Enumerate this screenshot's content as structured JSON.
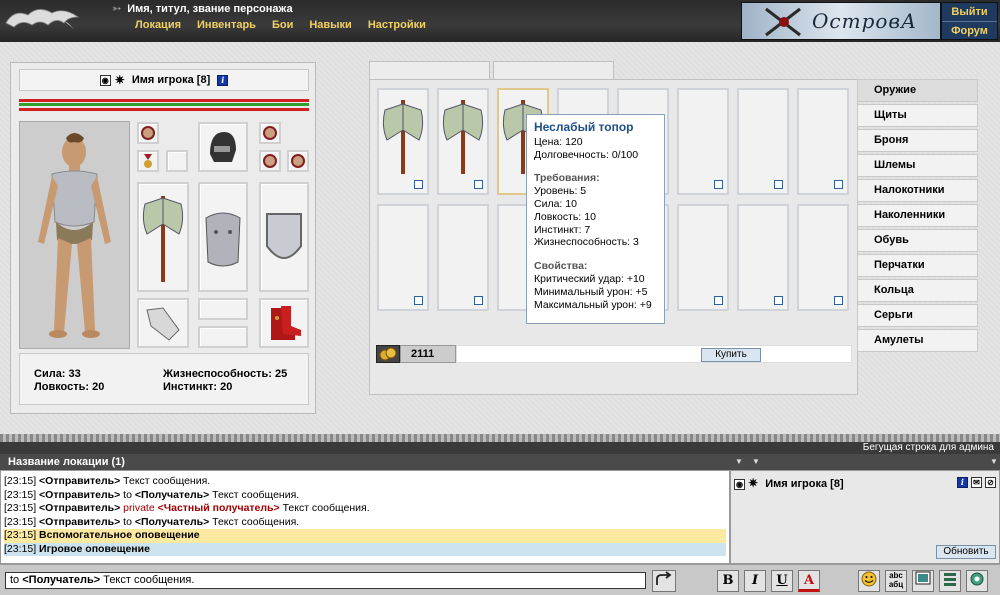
{
  "header": {
    "char_title": "Имя, титул, звание персонажа",
    "nav": [
      "Локация",
      "Инвентарь",
      "Бои",
      "Навыки",
      "Настройки"
    ],
    "logo": "ОстровА",
    "exit_label": "Выйти",
    "forum_label": "Форум"
  },
  "character": {
    "name": "Имя игрока [8]",
    "stats": {
      "str_label": "Сила: 33",
      "agi_label": "Ловкость: 20",
      "vit_label": "Жизнеспособность: 25",
      "ins_label": "Инстинкт: 20"
    }
  },
  "shop": {
    "money": "2111",
    "buy_label": "Купить",
    "categories": [
      "Оружие",
      "Щиты",
      "Броня",
      "Шлемы",
      "Налокотники",
      "Наколенники",
      "Обувь",
      "Перчатки",
      "Кольца",
      "Серьги",
      "Амулеты"
    ],
    "active_category": "Оружие"
  },
  "tooltip": {
    "title": "Неслабый топор",
    "price": "Цена: 120",
    "durability": "Долговечность: 0/100",
    "req_head": "Требования:",
    "req_level": "Уровень: 5",
    "req_str": "Сила: 10",
    "req_agi": "Ловкость: 10",
    "req_ins": "Инстинкт: 7",
    "req_vit": "Жизнеспособность: 3",
    "props_head": "Свойства:",
    "prop_crit": "Критический удар: +10",
    "prop_min": "Минимальный урон: +5",
    "prop_max": "Максимальный урон: +9"
  },
  "chat": {
    "ticker": "Бегущая строка для админа",
    "location": "Название локации (1)",
    "lines": [
      {
        "ts": "[23:15]",
        "sender": "<Отправитель>",
        "text": " Текст сообщения."
      },
      {
        "ts": "[23:15]",
        "sender": "<Отправитель>",
        "to": " to ",
        "receiver": "<Получатель>",
        "text": " Текст сообщения."
      },
      {
        "ts": "[23:15]",
        "sender": "<Отправитель>",
        "priv": " private ",
        "receiver": "<Частный получатель>",
        "text": " Текст сообщения."
      },
      {
        "ts": "[23:15]",
        "sender": "<Отправитель>",
        "to": " to ",
        "receiver": "<Получатель>",
        "text": " Текст сообщения."
      }
    ],
    "notice1_ts": "[23:15]",
    "notice1": "Вспомогательное оповещение",
    "notice2_ts": "[23:15]",
    "notice2": "Игровое оповещение",
    "user_name": "Имя игрока [8]",
    "refresh_label": "Обновить",
    "input_to": "to ",
    "input_receiver": "<Получатель>",
    "input_text": " Текст сообщения.",
    "tools": {
      "bold": "B",
      "italic": "I",
      "underline": "U",
      "color": "A"
    }
  },
  "colors": {
    "accent_gold": "#f0d060",
    "hp_red": "#d02020",
    "mp_green": "#30a030",
    "private_red": "#a00000",
    "notice_yellow": "#fdeaa0",
    "notice_blue": "#cde3f0"
  }
}
